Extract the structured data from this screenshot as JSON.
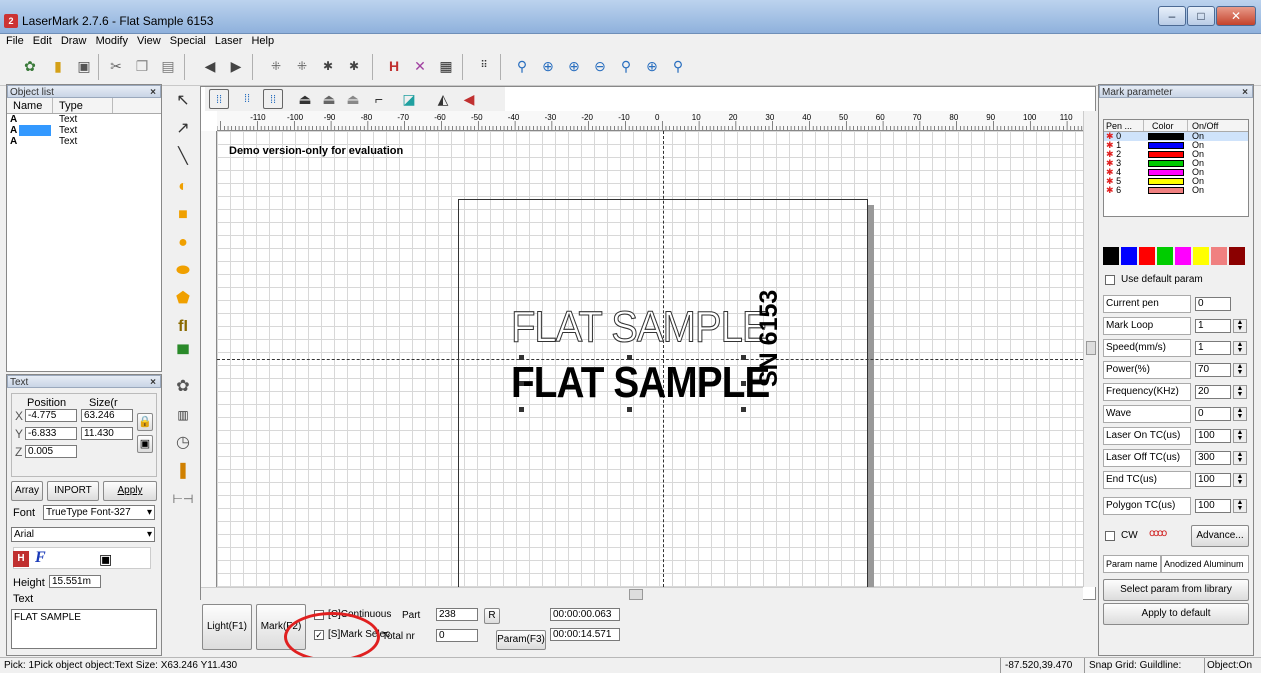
{
  "window": {
    "title": "LaserMark 2.7.6 - Flat Sample 6153",
    "app_icon": "2",
    "controls": [
      "–",
      "□",
      "✕"
    ]
  },
  "menu": [
    "File",
    "Edit",
    "Draw",
    "Modify",
    "View",
    "Special",
    "Laser",
    "Help"
  ],
  "object_list": {
    "title": "Object list",
    "columns": [
      "Name",
      "Type"
    ],
    "rows": [
      {
        "name": "A",
        "type": "Text"
      },
      {
        "name": "A",
        "type": "Text"
      },
      {
        "name": "A",
        "type": "Text"
      }
    ]
  },
  "text_panel": {
    "title": "Text",
    "position_label": "Position",
    "size_label": "Size(r",
    "x_label": "X",
    "y_label": "Y",
    "z_label": "Z",
    "x_pos": "-4.775",
    "y_pos": "-6.833",
    "z_pos": "0.005",
    "x_size": "63.246",
    "y_size": "11.430",
    "array_button": "Array",
    "inport_button": "INPORT",
    "apply_button": "Apply",
    "font_label": "Font",
    "font_type": "TrueType Font-327",
    "font_name": "Arial",
    "height_label": "Height",
    "height_value": "15.551m",
    "text_label": "Text",
    "text_value": "FLAT SAMPLE"
  },
  "canvas": {
    "watermark": "Demo version-only for evaluation",
    "ruler_ticks": [
      "-110",
      "-100",
      "-90",
      "-80",
      "-70",
      "-60",
      "-50",
      "-40",
      "-30",
      "-20",
      "-10",
      "0",
      "10",
      "20",
      "30",
      "40",
      "50",
      "60",
      "70",
      "80",
      "90",
      "100",
      "110"
    ],
    "text_outline": "FLAT SAMPLE",
    "text_bold": "FLAT SAMPLE",
    "text_vertical": "SN 6153"
  },
  "bottom": {
    "light_button": "Light(F1)",
    "mark_button": "Mark(F2)",
    "continuous_label": "[C]Continuous",
    "continuous_checked": false,
    "mark_selected_label": "[S]Mark Selec",
    "mark_selected_checked": true,
    "part_label": "Part",
    "part_value": "238",
    "r_button": "R",
    "total_label": "Total nr",
    "total_value": "0",
    "param_button": "Param(F3)",
    "time1": "00:00:00.063",
    "time2": "00:00:14.571"
  },
  "mark_param": {
    "title": "Mark parameter",
    "columns": [
      "Pen ...",
      "Color",
      "On/Off"
    ],
    "pens": [
      {
        "no": "0",
        "color": "#000000",
        "state": "On"
      },
      {
        "no": "1",
        "color": "#0000ff",
        "state": "On"
      },
      {
        "no": "2",
        "color": "#ff0000",
        "state": "On"
      },
      {
        "no": "3",
        "color": "#00cc00",
        "state": "On"
      },
      {
        "no": "4",
        "color": "#ff00ff",
        "state": "On"
      },
      {
        "no": "5",
        "color": "#ffff00",
        "state": "On"
      },
      {
        "no": "6",
        "color": "#f08080",
        "state": "On"
      }
    ],
    "palette": [
      "#000000",
      "#0000ff",
      "#ff0000",
      "#00cc00",
      "#ff00ff",
      "#ffff00",
      "#f08080",
      "#8b0000"
    ],
    "use_default_label": "Use default param",
    "params": [
      {
        "label": "Current pen",
        "value": "0"
      },
      {
        "label": "Mark Loop",
        "value": "1"
      },
      {
        "label": "Speed(mm/s)",
        "value": "1"
      },
      {
        "label": "Power(%)",
        "value": "70"
      },
      {
        "label": "Frequency(KHz)",
        "value": "20"
      },
      {
        "label": "Wave",
        "value": "0"
      },
      {
        "label": "Laser On TC(us)",
        "value": "100"
      },
      {
        "label": "Laser Off TC(us)",
        "value": "300"
      },
      {
        "label": "End TC(us)",
        "value": "100"
      },
      {
        "label": "Polygon TC(us)",
        "value": "100"
      }
    ],
    "cw_label": "CW",
    "advance_button": "Advance...",
    "param_name_label": "Param name",
    "param_name_value": "Anodized Aluminum",
    "select_button": "Select param from library",
    "apply_default_button": "Apply to default"
  },
  "status": {
    "left": "Pick: 1Pick object object:Text Size: X63.246 Y11.430",
    "coords": "-87.520,39.470",
    "snap": "Snap Grid: Guildline:",
    "object": "Object:On"
  }
}
